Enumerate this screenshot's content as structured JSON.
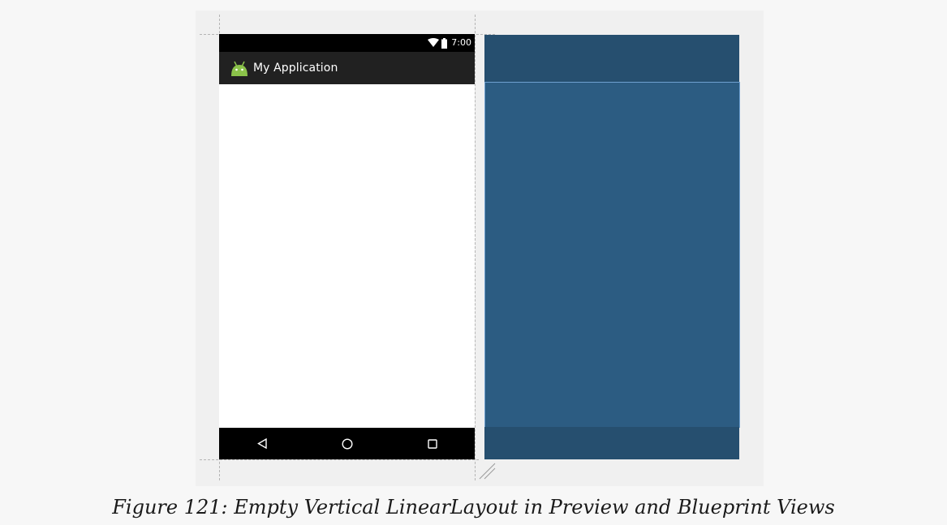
{
  "preview": {
    "status_time": "7:00",
    "app_title": "My Application",
    "icons": {
      "wifi": "wifi-icon",
      "battery": "battery-icon",
      "app_logo": "android-logo-icon",
      "nav_back": "back-triangle-icon",
      "nav_home": "home-circle-icon",
      "nav_recents": "recents-square-icon"
    }
  },
  "blueprint": {
    "colors": {
      "bars": "#264f6f",
      "body": "#2c5c82",
      "outline": "#6fa0d0"
    }
  },
  "caption": "Figure 121: Empty Vertical LinearLayout in Preview and Blueprint Views"
}
